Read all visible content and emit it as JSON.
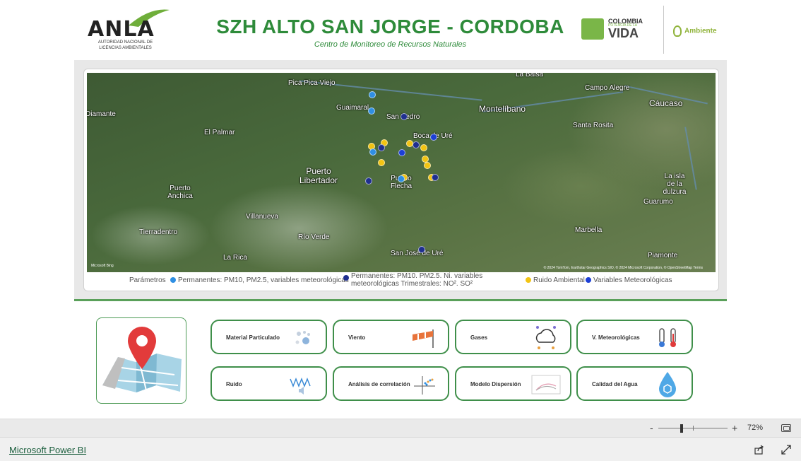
{
  "header": {
    "anla_logo_word": "ANLA",
    "anla_logo_sub": "AUTORIDAD NACIONAL DE LICENCIAS AMBIENTALES",
    "title": "SZH ALTO SAN JORGE - CORDOBA",
    "subtitle": "Centro de Monitoreo de Recursos Naturales",
    "colombia_logo_line1": "COLOMBIA",
    "colombia_logo_line2": "POTENCIA DE LA",
    "colombia_logo_line3": "VIDA",
    "ambiente_logo": "Ambiente"
  },
  "map": {
    "labels": [
      {
        "text": "La Balsa"
      },
      {
        "text": "Pica Pica Viejo"
      },
      {
        "text": "Campo Alegre"
      },
      {
        "text": "Cáucaso"
      },
      {
        "text": "Guaimaral"
      },
      {
        "text": "San Pedro"
      },
      {
        "text": "Montelíbano"
      },
      {
        "text": "Diamante"
      },
      {
        "text": "El Palmar"
      },
      {
        "text": "Santa Rosita"
      },
      {
        "text": "Boca de Uré"
      },
      {
        "text": "Puerto Libertador"
      },
      {
        "text": "Puerto Flecha"
      },
      {
        "text": "La isla de la dulzura"
      },
      {
        "text": "Puerto Anchica"
      },
      {
        "text": "Guarumo"
      },
      {
        "text": "Villanueva"
      },
      {
        "text": "Tierradentro"
      },
      {
        "text": "Río Verde"
      },
      {
        "text": "Marbella"
      },
      {
        "text": "La Rica"
      },
      {
        "text": "San José de Uré"
      },
      {
        "text": "Piamonte"
      }
    ],
    "attribution": "© 2024 TomTom, Earthstar Geographics SIO, © 2024 Microsoft Corporation, © OpenStreetMap  Terms",
    "bing": "Microsoft Bing",
    "dot_colors": {
      "permanentes": "#2f8fe3",
      "permanentes_trimestrales": "#1f2f8f",
      "ruido": "#f2c413",
      "meteo": "#1c3fd6"
    }
  },
  "legend": {
    "title": "Parámetros",
    "items": [
      {
        "label": "Permanentes: PM10, PM2.5, variables meteorológicas",
        "color": "#2f8fe3"
      },
      {
        "label": "Permanentes: PM10. PM2.5. Ni. variables meteorológicas Trimestrales: NO². SO²",
        "color": "#1f2f8f"
      },
      {
        "label": "Ruido Ambiental",
        "color": "#f2c413"
      },
      {
        "label": "Variables Meteorológicas",
        "color": "#1c3fd6"
      }
    ]
  },
  "buttons": [
    {
      "label": "Material Particulado",
      "icon": "particles-icon"
    },
    {
      "label": "Viento",
      "icon": "windsock-icon"
    },
    {
      "label": "Gases",
      "icon": "cloud-molecules-icon"
    },
    {
      "label": "V. Meteorológicas",
      "icon": "thermometer-icon"
    },
    {
      "label": "Ruido",
      "icon": "sound-wave-icon"
    },
    {
      "label": "Análisis de correlación",
      "icon": "scatter-plot-icon"
    },
    {
      "label": "Modelo Dispersión",
      "icon": "dispersion-chart-icon"
    },
    {
      "label": "Calidad del Agua",
      "icon": "water-drop-icon"
    }
  ],
  "zoom": {
    "minus": "-",
    "plus": "+",
    "percent": "72%"
  },
  "footer": {
    "powerbi_link": "Microsoft Power BI"
  }
}
